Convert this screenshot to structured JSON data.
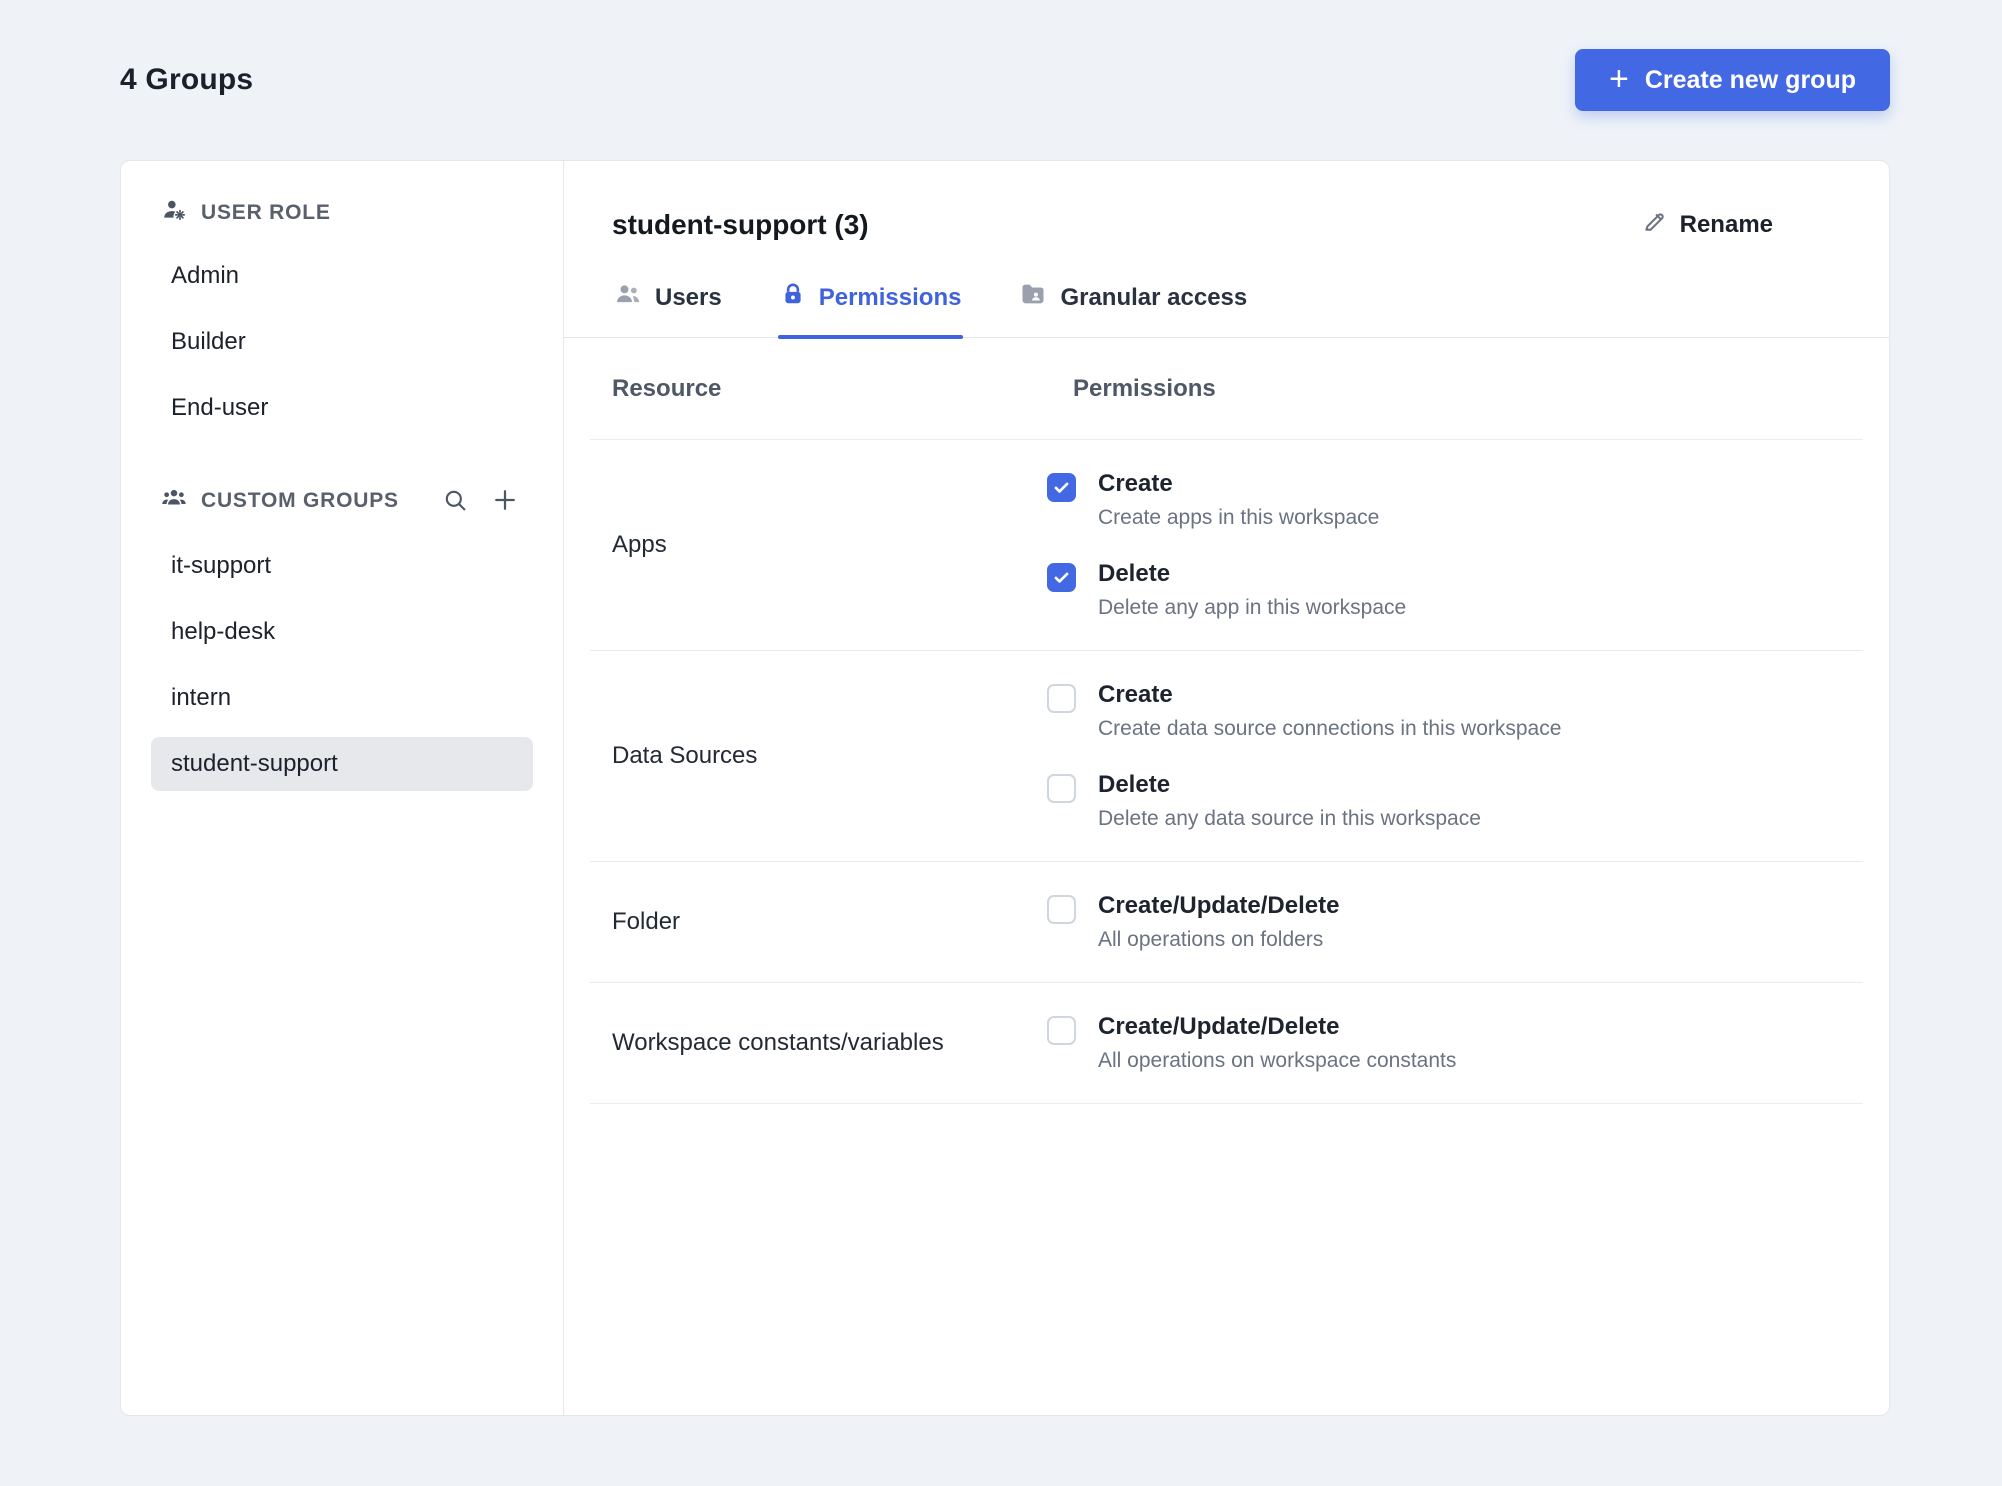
{
  "header": {
    "title": "4 Groups",
    "create_button": "Create new group",
    "create_button_plus": "+"
  },
  "sidebar": {
    "user_role": {
      "label": "USER ROLE",
      "items": [
        {
          "label": "Admin"
        },
        {
          "label": "Builder"
        },
        {
          "label": "End-user"
        }
      ]
    },
    "custom_groups": {
      "label": "CUSTOM GROUPS",
      "items": [
        {
          "label": "it-support",
          "selected": false
        },
        {
          "label": "help-desk",
          "selected": false
        },
        {
          "label": "intern",
          "selected": false
        },
        {
          "label": "student-support",
          "selected": true
        }
      ]
    }
  },
  "main": {
    "title": "student-support (3)",
    "rename_label": "Rename",
    "tabs": [
      {
        "label": "Users",
        "active": false,
        "icon": "users-icon"
      },
      {
        "label": "Permissions",
        "active": true,
        "icon": "lock-icon"
      },
      {
        "label": "Granular access",
        "active": false,
        "icon": "folder-icon"
      }
    ],
    "table": {
      "columns": {
        "resource": "Resource",
        "permissions": "Permissions"
      },
      "rows": [
        {
          "resource": "Apps",
          "permissions": [
            {
              "label": "Create",
              "description": "Create apps in this workspace",
              "checked": true
            },
            {
              "label": "Delete",
              "description": "Delete any app in this workspace",
              "checked": true
            }
          ]
        },
        {
          "resource": "Data Sources",
          "permissions": [
            {
              "label": "Create",
              "description": "Create data source connections in this workspace",
              "checked": false
            },
            {
              "label": "Delete",
              "description": "Delete any data source in this workspace",
              "checked": false
            }
          ]
        },
        {
          "resource": "Folder",
          "permissions": [
            {
              "label": "Create/Update/Delete",
              "description": "All operations on folders",
              "checked": false
            }
          ]
        },
        {
          "resource": "Workspace constants/variables",
          "permissions": [
            {
              "label": "Create/Update/Delete",
              "description": "All operations on workspace constants",
              "checked": false
            }
          ]
        }
      ]
    }
  },
  "colors": {
    "accent": "#4368e3",
    "tab_active": "#3e63dd",
    "page_background": "#eff3f8",
    "selected_item_background": "#e6e8eb"
  },
  "icons": {
    "create_button": "plus-icon",
    "user_role_section": "user-gear-icon",
    "custom_groups_section": "people-icon",
    "custom_groups_actions": [
      "search-icon",
      "plus-icon"
    ],
    "tab_users": "users-icon",
    "tab_permissions": "lock-icon",
    "tab_granular": "folder-icon",
    "rename": "pencil-icon",
    "checked_checkbox": "check-icon"
  }
}
